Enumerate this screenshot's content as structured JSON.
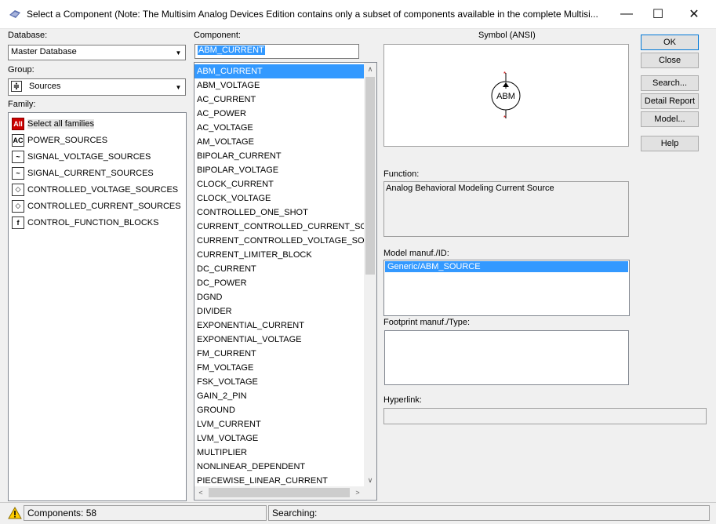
{
  "window": {
    "title": "Select a Component (Note: The Multisim Analog Devices Edition contains only a subset of components available in the complete Multisi...",
    "minimize": "—",
    "maximize": "☐",
    "close": "✕"
  },
  "database": {
    "label": "Database:",
    "value": "Master Database"
  },
  "group": {
    "label": "Group:",
    "value": "Sources"
  },
  "family": {
    "label": "Family:",
    "items": [
      {
        "icon": "All",
        "label": "Select all families"
      },
      {
        "icon": "AC",
        "label": "POWER_SOURCES"
      },
      {
        "icon": "~",
        "label": "SIGNAL_VOLTAGE_SOURCES"
      },
      {
        "icon": "~",
        "label": "SIGNAL_CURRENT_SOURCES"
      },
      {
        "icon": "◇",
        "label": "CONTROLLED_VOLTAGE_SOURCES"
      },
      {
        "icon": "◇",
        "label": "CONTROLLED_CURRENT_SOURCES"
      },
      {
        "icon": "f",
        "label": "CONTROL_FUNCTION_BLOCKS"
      }
    ]
  },
  "component": {
    "label": "Component:",
    "search_value": "ABM_CURRENT",
    "items": [
      "ABM_CURRENT",
      "ABM_VOLTAGE",
      "AC_CURRENT",
      "AC_POWER",
      "AC_VOLTAGE",
      "AM_VOLTAGE",
      "BIPOLAR_CURRENT",
      "BIPOLAR_VOLTAGE",
      "CLOCK_CURRENT",
      "CLOCK_VOLTAGE",
      "CONTROLLED_ONE_SHOT",
      "CURRENT_CONTROLLED_CURRENT_SOURC",
      "CURRENT_CONTROLLED_VOLTAGE_SOURC",
      "CURRENT_LIMITER_BLOCK",
      "DC_CURRENT",
      "DC_POWER",
      "DGND",
      "DIVIDER",
      "EXPONENTIAL_CURRENT",
      "EXPONENTIAL_VOLTAGE",
      "FM_CURRENT",
      "FM_VOLTAGE",
      "FSK_VOLTAGE",
      "GAIN_2_PIN",
      "GROUND",
      "LVM_CURRENT",
      "LVM_VOLTAGE",
      "MULTIPLIER",
      "NONLINEAR_DEPENDENT",
      "PIECEWISE_LINEAR_CURRENT"
    ]
  },
  "symbol": {
    "label": "Symbol (ANSI)",
    "text": "ABM"
  },
  "function": {
    "label": "Function:",
    "value": "Analog Behavioral Modeling Current Source"
  },
  "model": {
    "label": "Model manuf./ID:",
    "items": [
      "Generic/ABM_SOURCE"
    ]
  },
  "footprint": {
    "label": "Footprint manuf./Type:"
  },
  "hyperlink": {
    "label": "Hyperlink:"
  },
  "buttons": {
    "ok": "OK",
    "close": "Close",
    "search": "Search...",
    "detail_report": "Detail Report",
    "model": "Model...",
    "help": "Help"
  },
  "status": {
    "components": "Components: 58",
    "searching": "Searching:"
  },
  "colors": {
    "selection": "#3399ff",
    "icon_all_bg": "#cc0000"
  }
}
